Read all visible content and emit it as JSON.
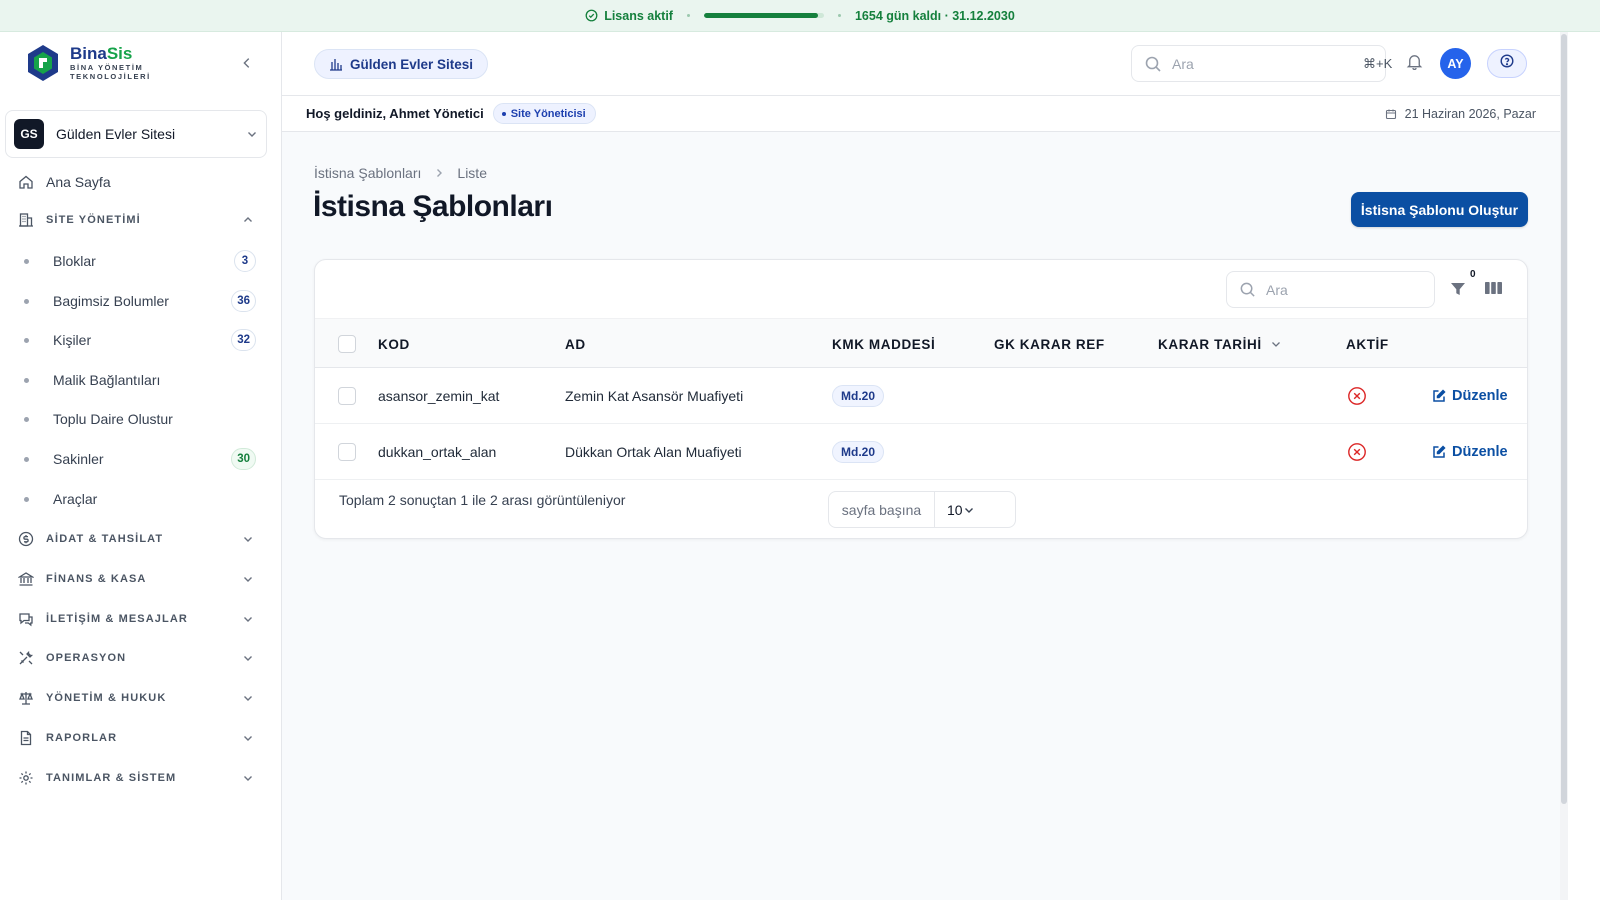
{
  "license": {
    "status": "Lisans aktif",
    "remaining": "1654 gün kaldı · 31.12.2030",
    "progress_fraction": 0.95,
    "color": "#15803d"
  },
  "brand": {
    "name_part1": "Bina",
    "name_part2": "Sis",
    "subtitle_line1": "BİNA YÖNETİM",
    "subtitle_line2": "TEKNOLOJİLERİ",
    "primary_color": "#1e3a8a"
  },
  "site_selector": {
    "initials": "GS",
    "name": "Gülden Evler Sitesi"
  },
  "sidebar": {
    "home": "Ana Sayfa",
    "site_section": "SİTE YÖNETİMİ",
    "site_items": [
      {
        "label": "Bloklar",
        "count": "3"
      },
      {
        "label": "Bagimsiz Bolumler",
        "count": "36"
      },
      {
        "label": "Kişiler",
        "count": "32"
      },
      {
        "label": "Malik Bağlantıları"
      },
      {
        "label": "Toplu Daire Olustur"
      },
      {
        "label": "Sakinler",
        "count": "30"
      },
      {
        "label": "Araçlar"
      }
    ],
    "sections": [
      {
        "label": "AİDAT & TAHSİLAT",
        "icon": "dollar-circle-icon"
      },
      {
        "label": "FİNANS & KASA",
        "icon": "bank-icon"
      },
      {
        "label": "İLETİŞİM & MESAJLAR",
        "icon": "chat-icon"
      },
      {
        "label": "OPERASYON",
        "icon": "tools-icon"
      },
      {
        "label": "YÖNETİM & HUKUK",
        "icon": "scale-icon"
      },
      {
        "label": "RAPORLAR",
        "icon": "file-icon"
      },
      {
        "label": "TANIMLAR & SİSTEM",
        "icon": "gear-icon"
      }
    ]
  },
  "header": {
    "site_chip": "Gülden Evler Sitesi",
    "search_placeholder": "Ara",
    "search_shortcut": "⌘+K",
    "user_initials": "AY",
    "avatar_color": "#2563eb"
  },
  "welcome": {
    "text": "Hoş geldiniz, Ahmet Yönetici",
    "role": "Site Yöneticisi",
    "date": "21 Haziran 2026, Pazar"
  },
  "page": {
    "breadcrumb": [
      "İstisna Şablonları",
      "Liste"
    ],
    "title": "İstisna Şablonları",
    "create_button": "İstisna Şablonu Oluştur",
    "accent_color": "#0b4fa3"
  },
  "table": {
    "search_placeholder": "Ara",
    "filter_count": "0",
    "columns": [
      "KOD",
      "AD",
      "KMK MADDESİ",
      "GK KARAR REF",
      "KARAR TARİHİ",
      "AKTİF"
    ],
    "rows": [
      {
        "kod": "asansor_zemin_kat",
        "ad": "Zemin Kat Asansör Muafiyeti",
        "kmk": "Md.20",
        "gk_ref": "",
        "karar_tarihi": "",
        "aktif": "false",
        "action": "Düzenle"
      },
      {
        "kod": "dukkan_ortak_alan",
        "ad": "Dükkan Ortak Alan Muafiyeti",
        "kmk": "Md.20",
        "gk_ref": "",
        "karar_tarihi": "",
        "aktif": "false",
        "action": "Düzenle"
      }
    ],
    "summary": "Toplam 2 sonuçtan 1 ile 2 arası görüntüleniyor",
    "per_page_label": "sayfa başına",
    "per_page_value": "10",
    "inactive_color": "#dc2626"
  }
}
